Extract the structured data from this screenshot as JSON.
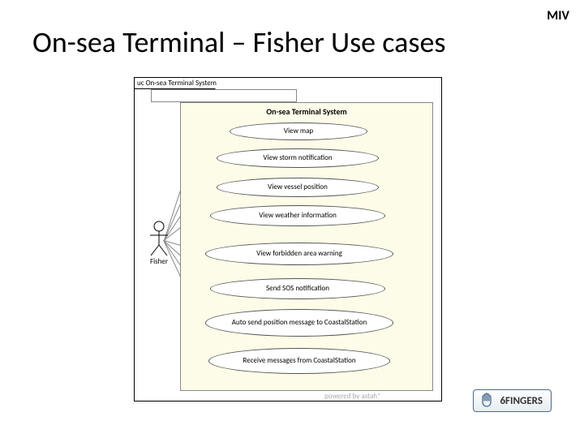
{
  "corner": "MIV",
  "title": "On-sea Terminal – Fisher Use cases",
  "diagram_tab": "uc On-sea Terminal System",
  "system_name": "On-sea Terminal System",
  "actor": "Fisher",
  "usecases": {
    "uc0": "View map",
    "uc1": "View storm notification",
    "uc2": "View vessel position",
    "uc3": "View weather information",
    "uc4": "View forbidden area warning",
    "uc5": "Send SOS notification",
    "uc6": "Auto send position message to CoastalStation",
    "uc7": "Receive messages from CoastalStation"
  },
  "footer": "powered by astah*",
  "brand": "6FINGERS"
}
